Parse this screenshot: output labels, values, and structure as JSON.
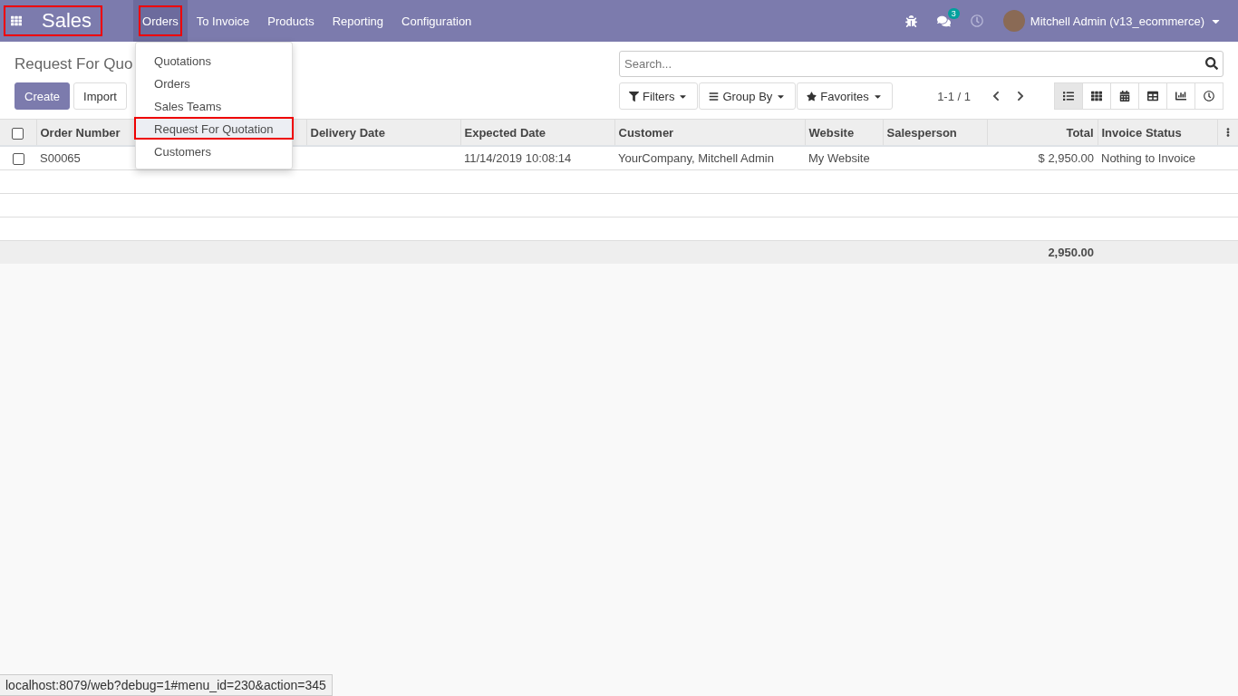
{
  "app": {
    "name": "Sales",
    "highlighted": true
  },
  "menu": [
    {
      "label": "Orders",
      "selected": true,
      "highlighted": true
    },
    {
      "label": "To Invoice",
      "selected": false,
      "highlighted": false
    },
    {
      "label": "Products",
      "selected": false,
      "highlighted": false
    },
    {
      "label": "Reporting",
      "selected": false,
      "highlighted": false
    },
    {
      "label": "Configuration",
      "selected": false,
      "highlighted": false
    }
  ],
  "dropdown": [
    {
      "label": "Quotations",
      "highlighted": false
    },
    {
      "label": "Orders",
      "highlighted": false
    },
    {
      "label": "Sales Teams",
      "highlighted": false
    },
    {
      "label": "Request For Quotation",
      "highlighted": true
    },
    {
      "label": "Customers",
      "highlighted": false
    }
  ],
  "messages_badge": "3",
  "user": "Mitchell Admin (v13_ecommerce)",
  "page_title": "Request For Quo",
  "buttons": [
    {
      "label": "Create",
      "kind": "primary"
    },
    {
      "label": "Import",
      "kind": "secondary"
    }
  ],
  "search": {
    "placeholder": "Search..."
  },
  "filters": [
    {
      "label": "Filters",
      "kind": "filter"
    },
    {
      "label": "Group By",
      "kind": "group"
    },
    {
      "label": "Favorites",
      "kind": "star"
    }
  ],
  "pager": "1-1 / 1",
  "views": [
    {
      "kind": "list",
      "selected": true
    },
    {
      "kind": "kanban",
      "selected": false
    },
    {
      "kind": "calendar",
      "selected": false
    },
    {
      "kind": "pivot",
      "selected": false
    },
    {
      "kind": "graph",
      "selected": false
    },
    {
      "kind": "activity",
      "selected": false
    }
  ],
  "table": {
    "select_all_checked": false,
    "columns": [
      {
        "label": "Order Number"
      },
      {},
      {
        "label": "Delivery Date"
      },
      {
        "label": "Expected Date"
      },
      {
        "label": "Customer"
      },
      {
        "label": "Website"
      },
      {
        "label": "Salesperson"
      },
      {
        "label": "Total",
        "kind": "amount"
      },
      {
        "label": "Invoice Status"
      }
    ],
    "rows": [
      {
        "checked": false,
        "cells": [
          "S00065",
          "",
          "",
          "11/14/2019 10:08:14",
          "YourCompany, Mitchell Admin",
          "My Website",
          "",
          "$ 2,950.00",
          "Nothing to Invoice"
        ]
      }
    ],
    "total": "2,950.00"
  },
  "status_bar": "localhost:8079/web?debug=1#menu_id=230&action=345"
}
